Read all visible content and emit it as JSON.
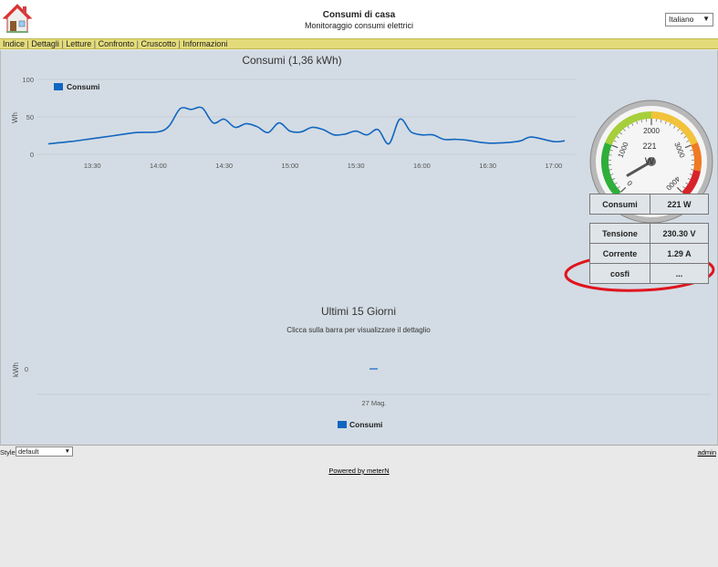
{
  "header": {
    "title": "Consumi di casa",
    "subtitle": "Monitoraggio consumi elettrici",
    "language": "Italiano",
    "home_icon": "house-icon"
  },
  "menu": [
    "Indice",
    "Dettagli",
    "Letture",
    "Confronto",
    "Cruscotto",
    "Informazioni"
  ],
  "colors": {
    "series": "#1266c0",
    "menubar": "#e3db7a",
    "panel": "#d3dce4",
    "annotation": "#e0141e"
  },
  "chart_data": [
    {
      "type": "line",
      "title": "Consumi (1,36 kWh)",
      "ylabel": "Wh",
      "ylim": [
        0,
        100
      ],
      "yticks": [
        "0",
        "50",
        "100"
      ],
      "xticks": [
        "13:30",
        "14:00",
        "14:30",
        "15:00",
        "15:30",
        "16:00",
        "16:30",
        "17:00"
      ],
      "legend": "top-left",
      "series": [
        {
          "name": "Consumi",
          "x": [
            "13:10",
            "13:20",
            "13:30",
            "13:40",
            "13:50",
            "14:00",
            "14:05",
            "14:10",
            "14:15",
            "14:20",
            "14:25",
            "14:30",
            "14:35",
            "14:40",
            "14:45",
            "14:50",
            "14:55",
            "15:00",
            "15:05",
            "15:10",
            "15:15",
            "15:20",
            "15:25",
            "15:30",
            "15:35",
            "15:40",
            "15:45",
            "15:50",
            "15:55",
            "16:00",
            "16:05",
            "16:10",
            "16:15",
            "16:20",
            "16:30",
            "16:40",
            "16:45",
            "16:50",
            "17:00",
            "17:05"
          ],
          "values": [
            14,
            17,
            21,
            25,
            29,
            30,
            38,
            61,
            60,
            62,
            42,
            47,
            36,
            41,
            37,
            29,
            42,
            31,
            30,
            36,
            33,
            26,
            27,
            31,
            26,
            33,
            14,
            47,
            30,
            26,
            26,
            20,
            20,
            19,
            15,
            16,
            18,
            23,
            17,
            18
          ]
        }
      ]
    },
    {
      "type": "bar",
      "title": "Ultimi 15 Giorni",
      "subtitle": "Clicca sulla barra per visualizzare il dettaglio",
      "ylabel": "kWh",
      "yticks": [
        "0"
      ],
      "categories": [
        "27 Mag."
      ],
      "series": [
        {
          "name": "Consumi",
          "values": [
            0
          ]
        }
      ],
      "legend": "bottom-center"
    }
  ],
  "gauge": {
    "unit": "W",
    "value": 221,
    "min": 0,
    "max": 4000,
    "labels": [
      "0",
      "1000",
      "2000",
      "3000",
      "4000"
    ]
  },
  "consumi_table": {
    "label": "Consumi",
    "value": "221 W"
  },
  "measures_table": [
    {
      "label": "Tensione",
      "value": "230.30 V"
    },
    {
      "label": "Corrente",
      "value": "1.29 A"
    },
    {
      "label": "cosfi",
      "value": "..."
    }
  ],
  "footer": {
    "style_label": "Style:",
    "style_value": "default",
    "admin": "admin",
    "powered": "Powered by meterN"
  }
}
